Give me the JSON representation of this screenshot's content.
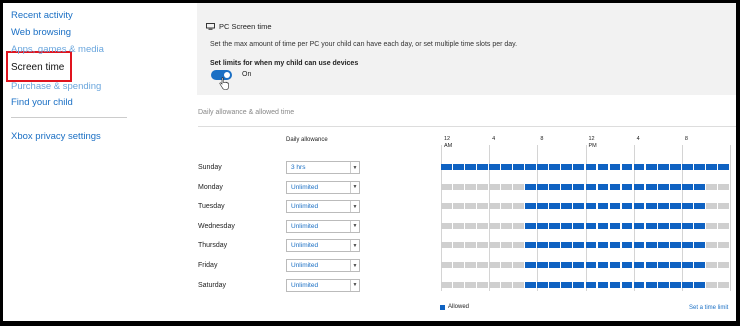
{
  "sidebar": {
    "items": [
      {
        "label": "Recent activity",
        "state": "normal"
      },
      {
        "label": "Web browsing",
        "state": "normal"
      },
      {
        "label": "Apps, games & media",
        "state": "dim"
      },
      {
        "label": "Screen time",
        "state": "active"
      },
      {
        "label": "Purchase & spending",
        "state": "dim"
      },
      {
        "label": "Find your child",
        "state": "normal"
      }
    ],
    "secondary_items": [
      {
        "label": "Xbox privacy settings"
      }
    ]
  },
  "panel": {
    "title_icon": "monitor-icon",
    "title": "PC Screen time",
    "description": "Set the max amount of time per PC your child can have each day, or set multiple time slots per day.",
    "limits_label": "Set limits for when my child can use devices",
    "toggle_on": true,
    "toggle_state_text": "On"
  },
  "schedule": {
    "section_label": "Daily allowance & allowed time",
    "allowance_header": "Daily allowance",
    "time_ticks": [
      {
        "lines": [
          "12",
          "AM"
        ]
      },
      {
        "lines": [
          "4"
        ]
      },
      {
        "lines": [
          "8"
        ]
      },
      {
        "lines": [
          "12",
          "PM"
        ]
      },
      {
        "lines": [
          "4"
        ]
      },
      {
        "lines": [
          "8"
        ]
      }
    ],
    "cells_per_day": 24,
    "days": [
      {
        "day": "Sunday",
        "allowance": "3 hrs",
        "allowed_start_hour": 0,
        "allowed_end_hour": 24
      },
      {
        "day": "Monday",
        "allowance": "Unlimited",
        "allowed_start_hour": 7,
        "allowed_end_hour": 22
      },
      {
        "day": "Tuesday",
        "allowance": "Unlimited",
        "allowed_start_hour": 7,
        "allowed_end_hour": 22
      },
      {
        "day": "Wednesday",
        "allowance": "Unlimited",
        "allowed_start_hour": 7,
        "allowed_end_hour": 22
      },
      {
        "day": "Thursday",
        "allowance": "Unlimited",
        "allowed_start_hour": 7,
        "allowed_end_hour": 22
      },
      {
        "day": "Friday",
        "allowance": "Unlimited",
        "allowed_start_hour": 7,
        "allowed_end_hour": 22
      },
      {
        "day": "Saturday",
        "allowance": "Unlimited",
        "allowed_start_hour": 7,
        "allowed_end_hour": 22
      }
    ],
    "legend_label": "Allowed",
    "set_limit_link": "Set a time limit"
  },
  "colors": {
    "allowed": "#0f62c2",
    "blocked": "#cfcfcf",
    "accent": "#1a6fc4",
    "highlight_box": "#e0141e"
  }
}
